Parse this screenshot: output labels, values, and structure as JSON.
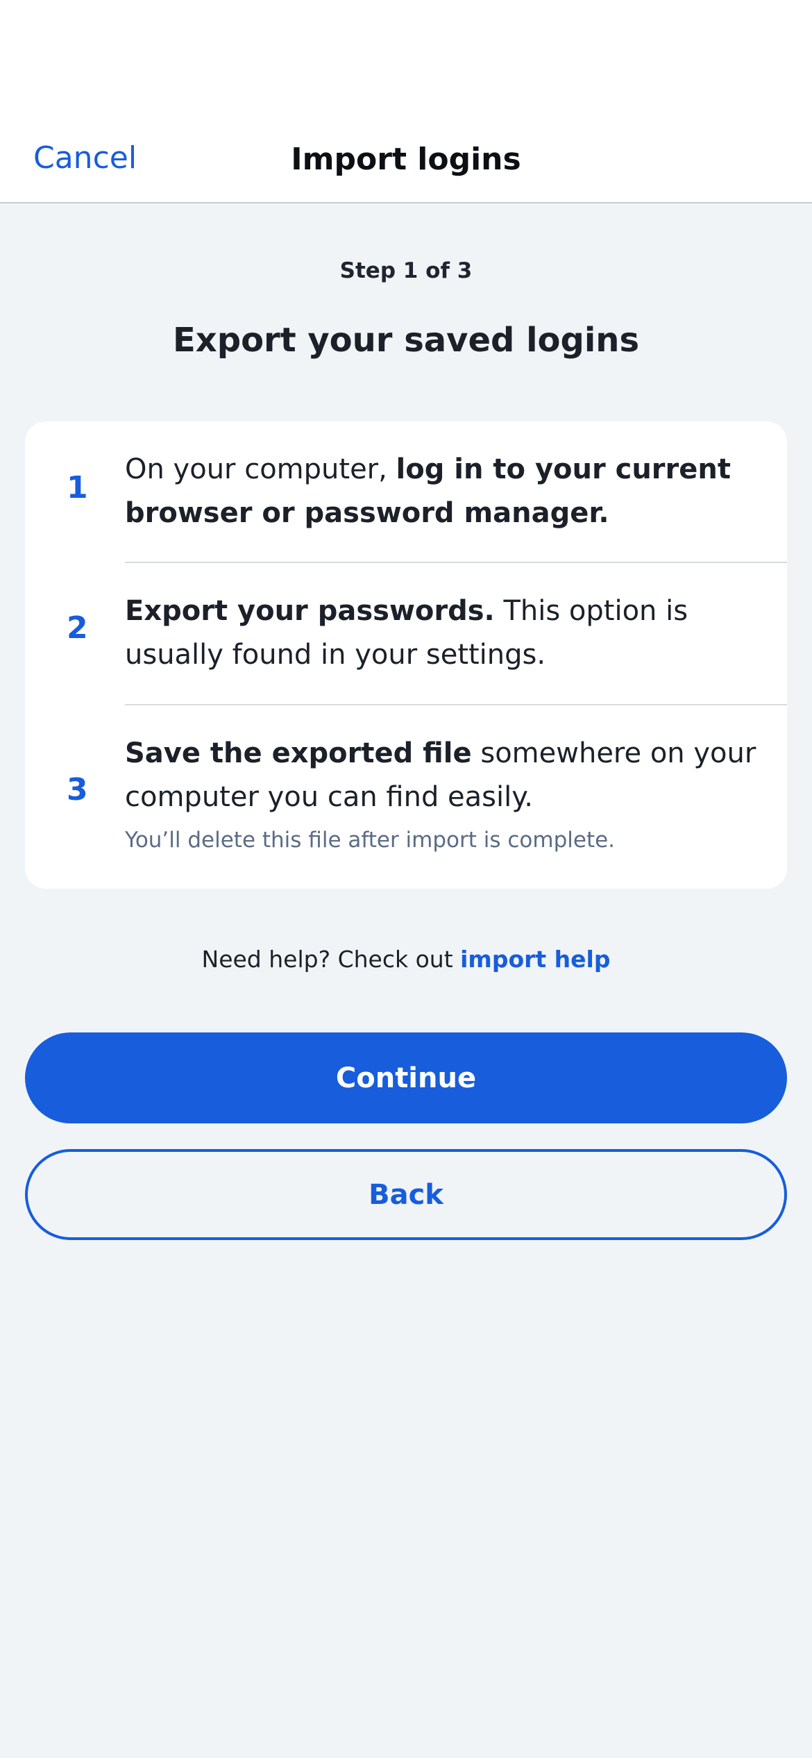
{
  "nav": {
    "cancel_label": "Cancel",
    "title": "Import logins"
  },
  "step": {
    "label": "Step 1 of 3"
  },
  "heading": "Export your saved logins",
  "steps": [
    {
      "number": "1",
      "text_plain": "On your computer, ",
      "text_bold": "log in to your current browser or password manager."
    },
    {
      "number": "2",
      "text_bold": "Export your passwords.",
      "text_plain": " This option is usually found in your settings."
    },
    {
      "number": "3",
      "text_bold": "Save the exported file",
      "text_plain": " somewhere on your computer you can find easily.",
      "note": "You’ll delete this file after import is complete."
    }
  ],
  "help": {
    "prefix": "Need help? Check out ",
    "link_label": "import help"
  },
  "buttons": {
    "continue_label": "Continue",
    "back_label": "Back"
  },
  "colors": {
    "accent": "#175ddc",
    "background": "#f1f4f7",
    "card": "#ffffff",
    "text": "#1b2029",
    "muted": "#5a6b85"
  }
}
